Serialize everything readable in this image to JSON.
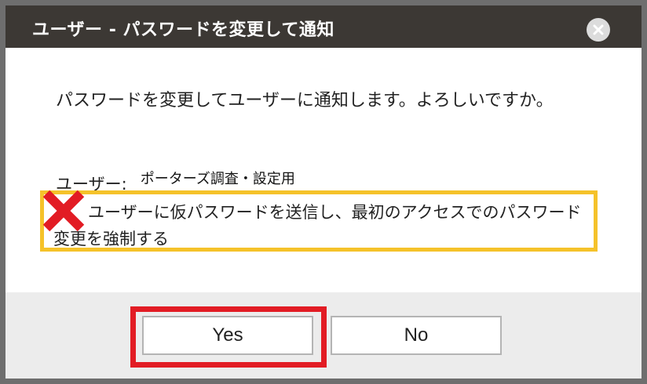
{
  "dialog": {
    "title": "ユーザー - パスワードを変更して通知",
    "close_icon": "close-icon"
  },
  "body": {
    "message": "パスワードを変更してユーザーに通知します。よろしいですか。",
    "user_label": "ユーザー:",
    "user_value": "ポーターズ調査・設定用",
    "option_text": "ユーザーに仮パスワードを送信し、最初のアクセスでのパスワード変更を強制する",
    "option_checked": false
  },
  "footer": {
    "yes_label": "Yes",
    "no_label": "No"
  },
  "annotation": {
    "x_mark_icon": "x-mark-icon",
    "option_highlight_color": "#f5c22a",
    "yes_highlight_color": "#e21c24",
    "x_mark_color": "#e21c24"
  }
}
